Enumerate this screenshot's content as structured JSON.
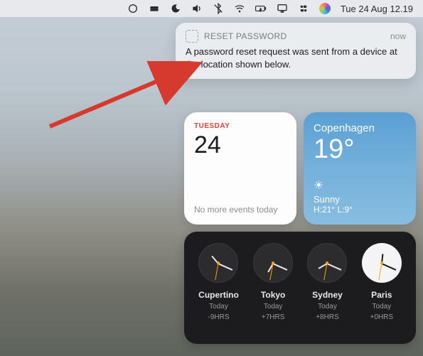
{
  "menubar": {
    "datetime": "Tue 24 Aug  12.19"
  },
  "notification": {
    "title": "RESET PASSWORD",
    "time": "now",
    "body": "A password reset request was sent from a device at the location shown below."
  },
  "calendar": {
    "day_label": "TUESDAY",
    "date": "24",
    "events": "No more events today"
  },
  "weather": {
    "city": "Copenhagen",
    "temp": "19°",
    "sun_icon": "☀︎",
    "condition": "Sunny",
    "hilo": "H:21° L:9°"
  },
  "clocks": [
    {
      "city": "Cupertino",
      "label": "Today",
      "offset": "-9HRS",
      "face": "dark",
      "hour_angle": -130,
      "min_angle": 24,
      "sec_angle": 100
    },
    {
      "city": "Tokyo",
      "label": "Today",
      "offset": "+7HRS",
      "face": "dark",
      "hour_angle": 120,
      "min_angle": 24,
      "sec_angle": 100
    },
    {
      "city": "Sydney",
      "label": "Today",
      "offset": "+8HRS",
      "face": "dark",
      "hour_angle": 150,
      "min_angle": 24,
      "sec_angle": 100
    },
    {
      "city": "Paris",
      "label": "Today",
      "offset": "+0HRS",
      "face": "light",
      "hour_angle": -84,
      "min_angle": 24,
      "sec_angle": 100
    }
  ]
}
